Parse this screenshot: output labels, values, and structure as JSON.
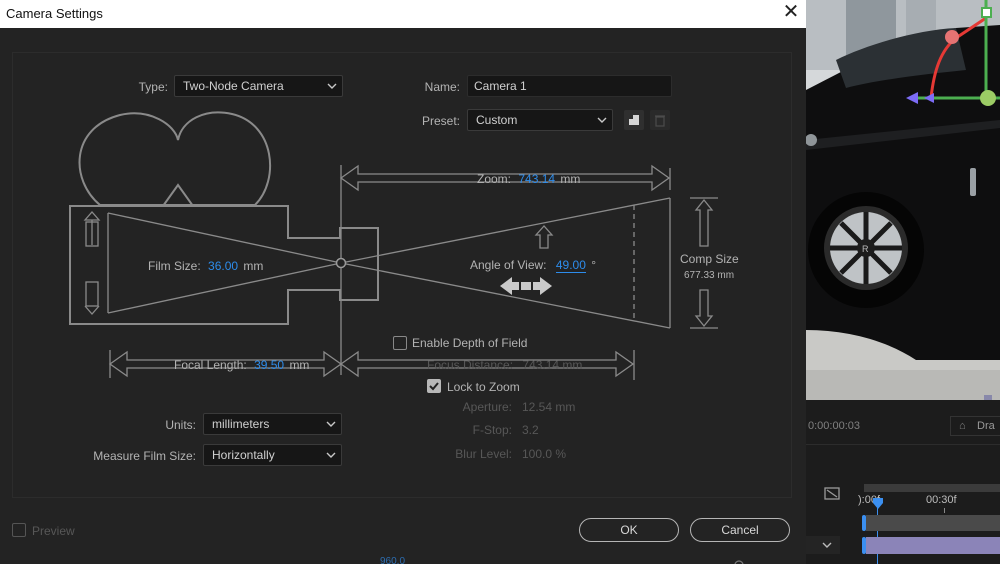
{
  "dialog": {
    "title": "Camera Settings",
    "close_glyph": "✕"
  },
  "type": {
    "label": "Type:",
    "value": "Two-Node Camera"
  },
  "name": {
    "label": "Name:",
    "value": "Camera 1"
  },
  "preset": {
    "label": "Preset:",
    "value": "Custom"
  },
  "diagram": {
    "zoom_label": "Zoom:",
    "zoom_value": "743.14",
    "zoom_unit": "mm",
    "film_size_label": "Film Size:",
    "film_size_value": "36.00",
    "film_size_unit": "mm",
    "angle_label": "Angle of View:",
    "angle_value": "49.00",
    "angle_unit": "°",
    "comp_size_label": "Comp Size",
    "comp_size_value": "677.33 mm",
    "focal_label": "Focal Length:",
    "focal_value": "39.50",
    "focal_unit": "mm"
  },
  "depth_of_field": {
    "enable_label": "Enable Depth of Field",
    "enabled": false,
    "focus_distance_label": "Focus Distance:",
    "focus_distance_value": "743.14 mm",
    "lock_label": "Lock to Zoom",
    "locked": true,
    "aperture_label": "Aperture:",
    "aperture_value": "12.54 mm",
    "fstop_label": "F-Stop:",
    "fstop_value": "3.2",
    "blur_label": "Blur Level:",
    "blur_value": "100.0 %"
  },
  "units": {
    "label": "Units:",
    "value": "millimeters"
  },
  "measure": {
    "label": "Measure Film Size:",
    "value": "Horizontally"
  },
  "footer": {
    "preview_label": "Preview",
    "ok_label": "OK",
    "cancel_label": "Cancel",
    "bottom_partial": "960.0"
  },
  "timeline": {
    "timecode": "0:00:00:03",
    "draft_label": "Dra",
    "ruler_left": "):00f",
    "ruler_mark": "00:30f"
  },
  "colors": {
    "accent_blue": "#2d8ceb",
    "dialog_bg": "#232323",
    "field_bg": "#161616"
  }
}
